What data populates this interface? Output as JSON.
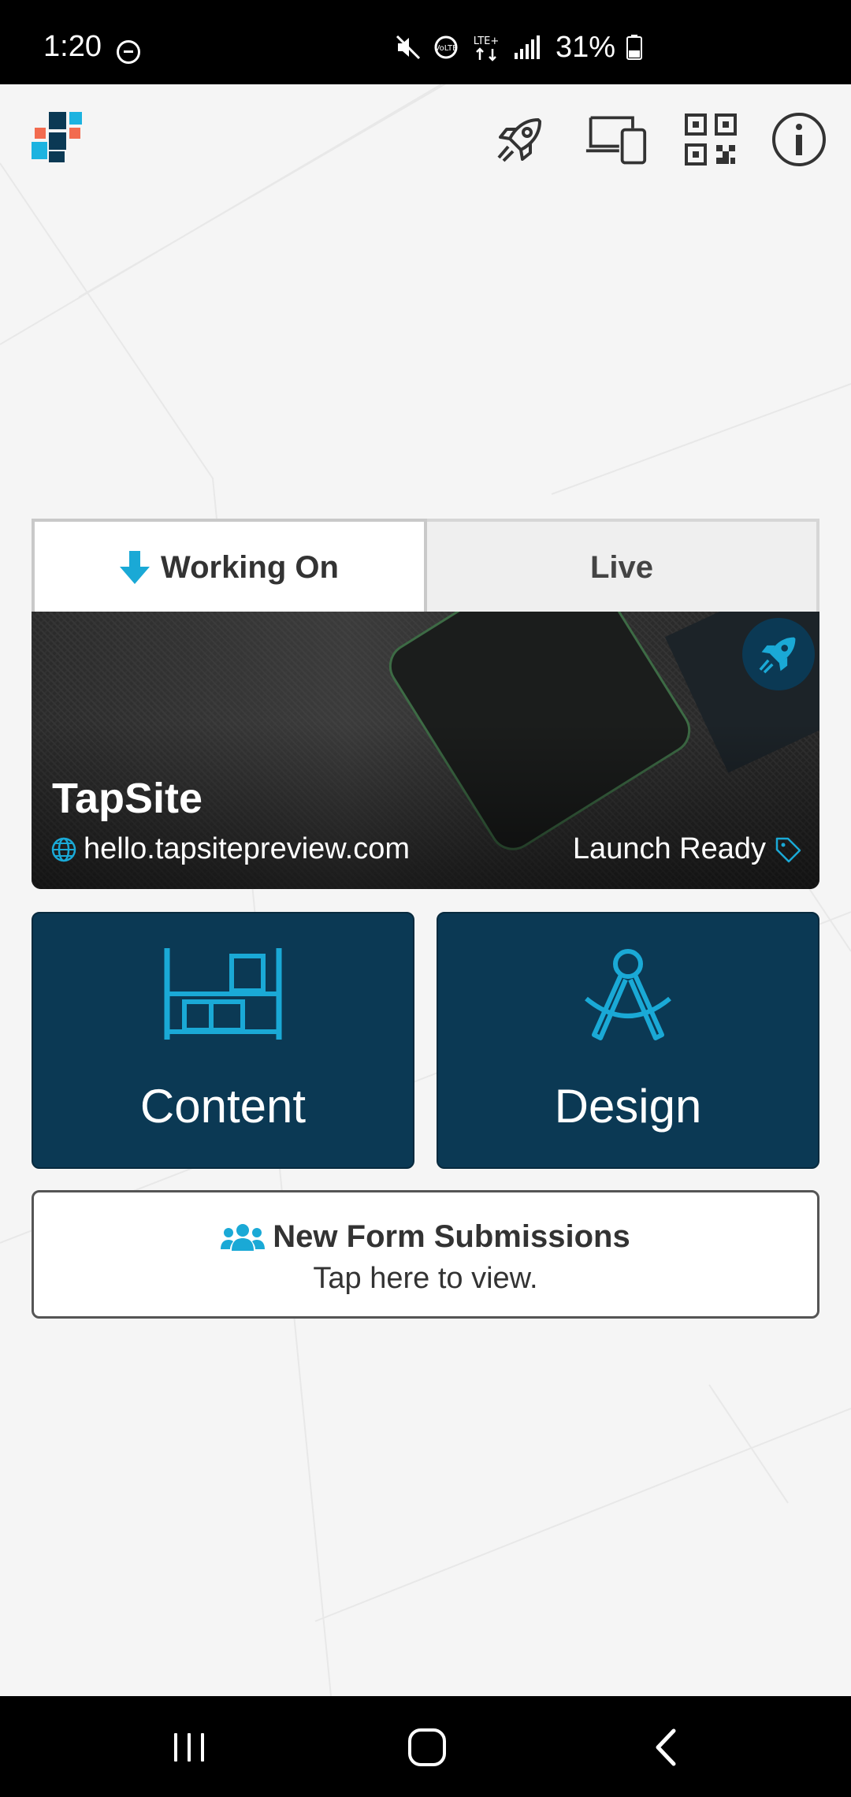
{
  "status_bar": {
    "time": "1:20",
    "battery": "31%",
    "network_label": "LTE+",
    "volte_label": "VoLTE"
  },
  "top_bar": {
    "icons": [
      "logo-icon",
      "rocket-icon",
      "devices-icon",
      "qr-code-icon",
      "info-icon"
    ]
  },
  "tabs": [
    {
      "label": "Working On",
      "active": true,
      "icon": "arrow-down-icon"
    },
    {
      "label": "Live",
      "active": false
    }
  ],
  "site_card": {
    "title": "TapSite",
    "url": "hello.tapsitepreview.com",
    "status": "Launch Ready",
    "badge_icon": "rocket-icon",
    "url_icon": "globe-icon",
    "status_icon": "tag-icon"
  },
  "tiles": [
    {
      "label": "Content",
      "icon": "shelves-icon"
    },
    {
      "label": "Design",
      "icon": "compass-icon"
    }
  ],
  "form_submissions": {
    "title": "New Form Submissions",
    "subtitle": "Tap here to view.",
    "icon": "users-icon"
  },
  "nav_bar": {
    "buttons": [
      "recents-icon",
      "home-icon",
      "back-icon"
    ]
  },
  "colors": {
    "accent": "#1aa9d6",
    "tile_bg": "#0b3954",
    "logo_orange": "#f26b4f",
    "logo_dark": "#0b3954",
    "logo_light": "#1cb3e0"
  }
}
